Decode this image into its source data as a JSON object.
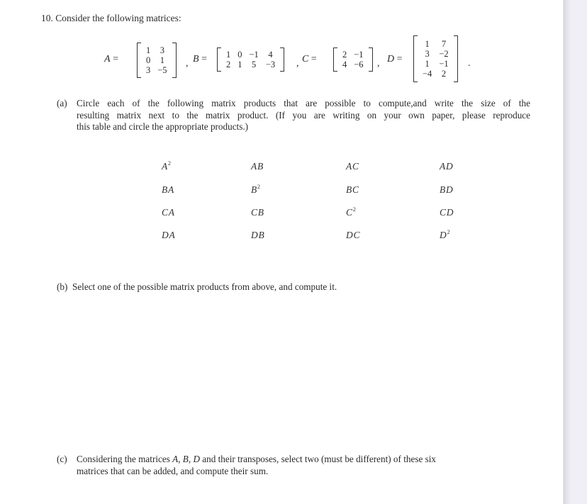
{
  "question": {
    "number": "10.",
    "intro": "Consider the following matrices:"
  },
  "matrices": {
    "A": {
      "name": "A",
      "rows": [
        [
          "1",
          "3"
        ],
        [
          "0",
          "1"
        ],
        [
          "3",
          "−5"
        ]
      ]
    },
    "B": {
      "name": "B",
      "rows": [
        [
          "1",
          "0",
          "−1",
          "4"
        ],
        [
          "2",
          "1",
          "5",
          "−3"
        ]
      ]
    },
    "C": {
      "name": "C",
      "rows": [
        [
          "2",
          "−1"
        ],
        [
          "4",
          "−6"
        ]
      ]
    },
    "D": {
      "name": "D",
      "rows": [
        [
          "1",
          "7"
        ],
        [
          "3",
          "−2"
        ],
        [
          "1",
          "−1"
        ],
        [
          "−4",
          "2"
        ]
      ]
    }
  },
  "part_a": {
    "label": "(a)",
    "lines": [
      "Circle each of the following matrix products that are possible to compute,and write the size of the",
      "resulting matrix next to the matrix product. (If you are writing on your own paper, please reproduce",
      "this table and circle the appropriate products.)"
    ],
    "products": [
      [
        {
          "base": "A",
          "sup": "2"
        },
        {
          "base": "AB",
          "sup": ""
        },
        {
          "base": "AC",
          "sup": ""
        },
        {
          "base": "AD",
          "sup": ""
        }
      ],
      [
        {
          "base": "BA",
          "sup": ""
        },
        {
          "base": "B",
          "sup": "2"
        },
        {
          "base": "BC",
          "sup": ""
        },
        {
          "base": "BD",
          "sup": ""
        }
      ],
      [
        {
          "base": "CA",
          "sup": ""
        },
        {
          "base": "CB",
          "sup": ""
        },
        {
          "base": "C",
          "sup": "2"
        },
        {
          "base": "CD",
          "sup": ""
        }
      ],
      [
        {
          "base": "DA",
          "sup": ""
        },
        {
          "base": "DB",
          "sup": ""
        },
        {
          "base": "DC",
          "sup": ""
        },
        {
          "base": "D",
          "sup": "2"
        }
      ]
    ]
  },
  "part_b": {
    "label": "(b)",
    "text": "Select one of the possible matrix products from above, and compute it."
  },
  "part_c": {
    "label": "(c)",
    "line1_pre": "Considering the matrices ",
    "line1_math": "A, B, D",
    "line1_post": " and their transposes, select two (must be different) of these six",
    "line2": "matrices that can be added, and compute their sum."
  },
  "punct": {
    "eq": " =",
    "comma": ",",
    "period": "."
  }
}
